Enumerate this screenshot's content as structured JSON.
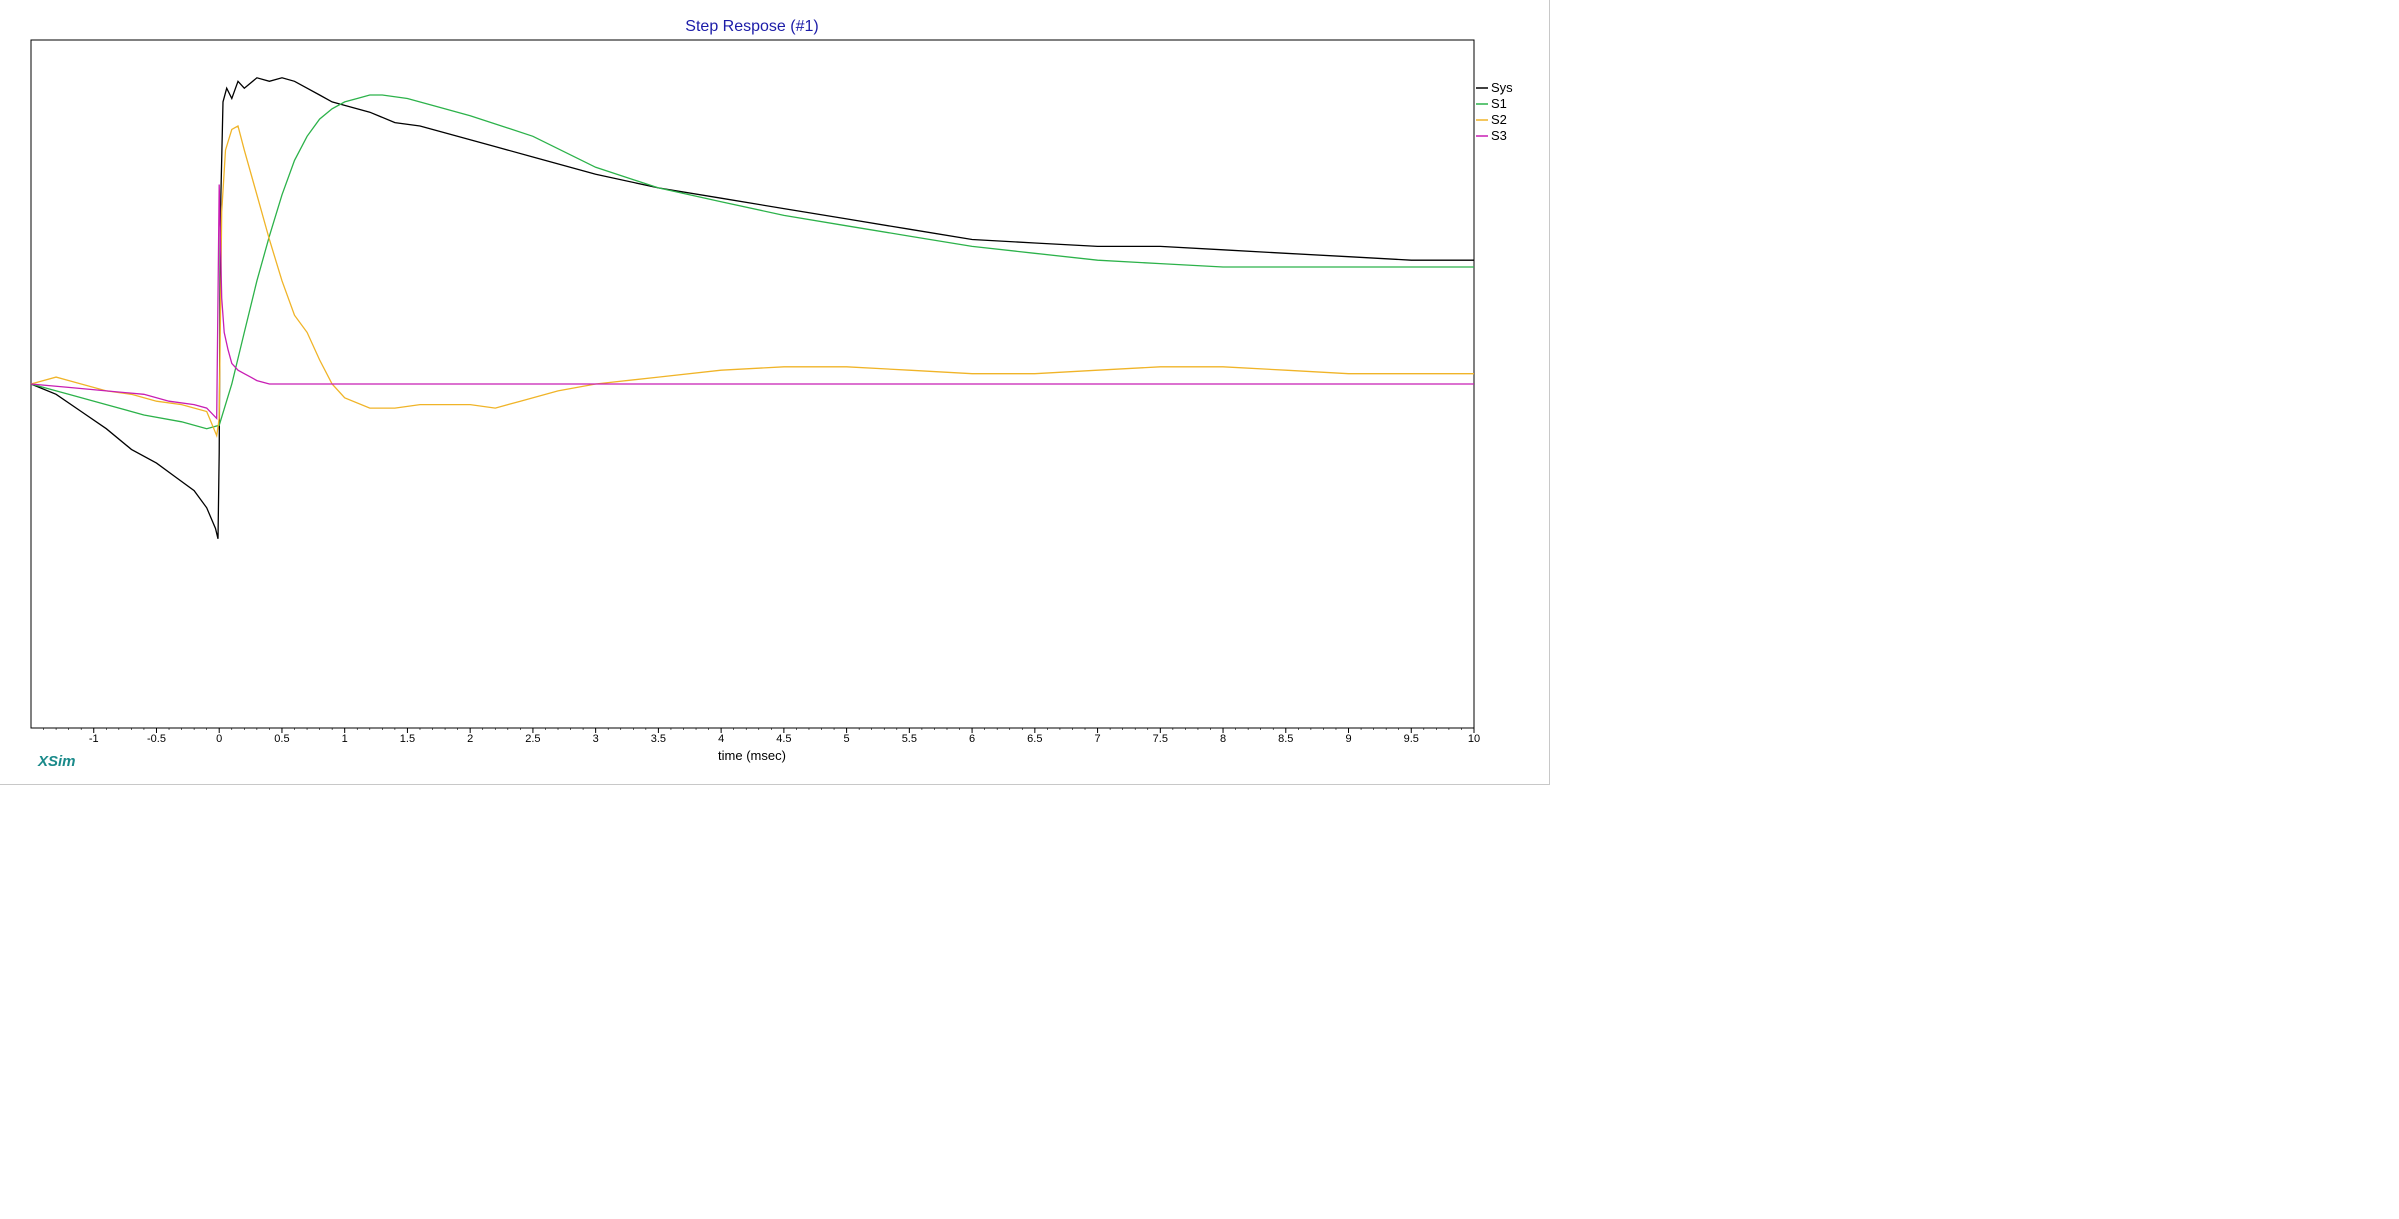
{
  "chart_data": {
    "type": "line",
    "title": "Step Respose (#1)",
    "xlabel": "time (msec)",
    "ylabel": "",
    "xlim": [
      -1.5,
      10
    ],
    "ylim": [
      -1.0,
      1.0
    ],
    "grid": false,
    "legend_position": "right-top",
    "x_ticks": [
      -1,
      -0.5,
      0,
      0.5,
      1,
      1.5,
      2,
      2.5,
      3,
      3.5,
      4,
      4.5,
      5,
      5.5,
      6,
      6.5,
      7,
      7.5,
      8,
      8.5,
      9,
      9.5,
      10
    ],
    "x_tick_labels": [
      "-1",
      "-0.5",
      "0",
      "0.5",
      "1",
      "1.5",
      "2",
      "2.5",
      "3",
      "3.5",
      "4",
      "4.5",
      "5",
      "5.5",
      "6",
      "6.5",
      "7",
      "7.5",
      "8",
      "8.5",
      "9",
      "9.5",
      "10"
    ],
    "series": [
      {
        "name": "Sys",
        "color": "#000000",
        "x": [
          -1.5,
          -1.3,
          -1.1,
          -0.9,
          -0.7,
          -0.5,
          -0.35,
          -0.2,
          -0.1,
          -0.03,
          -0.01,
          0.0,
          0.01,
          0.03,
          0.06,
          0.1,
          0.15,
          0.2,
          0.3,
          0.4,
          0.5,
          0.6,
          0.7,
          0.8,
          0.9,
          1.0,
          1.2,
          1.4,
          1.6,
          1.8,
          2.0,
          2.2,
          2.5,
          3.0,
          3.5,
          4.0,
          4.5,
          5.0,
          5.5,
          6.0,
          6.5,
          7.0,
          7.5,
          8.0,
          8.5,
          9.0,
          9.5,
          10.0
        ],
        "y": [
          0.0,
          -0.03,
          -0.08,
          -0.13,
          -0.19,
          -0.23,
          -0.27,
          -0.31,
          -0.36,
          -0.42,
          -0.45,
          -0.2,
          0.5,
          0.82,
          0.86,
          0.83,
          0.88,
          0.86,
          0.89,
          0.88,
          0.89,
          0.88,
          0.86,
          0.84,
          0.82,
          0.81,
          0.79,
          0.76,
          0.75,
          0.73,
          0.71,
          0.69,
          0.66,
          0.61,
          0.57,
          0.54,
          0.51,
          0.48,
          0.45,
          0.42,
          0.41,
          0.4,
          0.4,
          0.39,
          0.38,
          0.37,
          0.36,
          0.36
        ]
      },
      {
        "name": "S1",
        "color": "#2cb24a",
        "x": [
          -1.5,
          -1.2,
          -0.9,
          -0.6,
          -0.3,
          -0.1,
          0.0,
          0.1,
          0.2,
          0.3,
          0.4,
          0.5,
          0.6,
          0.7,
          0.8,
          0.9,
          1.0,
          1.1,
          1.2,
          1.3,
          1.5,
          1.7,
          2.0,
          2.5,
          3.0,
          3.5,
          4.0,
          4.5,
          5.0,
          5.5,
          6.0,
          6.5,
          7.0,
          7.5,
          8.0,
          8.5,
          9.0,
          9.5,
          10.0
        ],
        "y": [
          0.0,
          -0.03,
          -0.06,
          -0.09,
          -0.11,
          -0.13,
          -0.12,
          0.0,
          0.15,
          0.3,
          0.43,
          0.55,
          0.65,
          0.72,
          0.77,
          0.8,
          0.82,
          0.83,
          0.84,
          0.84,
          0.83,
          0.81,
          0.78,
          0.72,
          0.63,
          0.57,
          0.53,
          0.49,
          0.46,
          0.43,
          0.4,
          0.38,
          0.36,
          0.35,
          0.34,
          0.34,
          0.34,
          0.34,
          0.34
        ]
      },
      {
        "name": "S2",
        "color": "#f0b428",
        "x": [
          -1.5,
          -1.3,
          -1.1,
          -0.9,
          -0.7,
          -0.5,
          -0.3,
          -0.1,
          -0.02,
          0.0,
          0.02,
          0.05,
          0.1,
          0.15,
          0.2,
          0.3,
          0.4,
          0.5,
          0.6,
          0.7,
          0.8,
          0.9,
          1.0,
          1.2,
          1.4,
          1.6,
          1.8,
          2.0,
          2.2,
          2.4,
          2.7,
          3.0,
          3.5,
          4.0,
          4.5,
          5.0,
          5.5,
          6.0,
          6.5,
          7.0,
          7.5,
          8.0,
          8.5,
          9.0,
          9.5,
          10.0
        ],
        "y": [
          0.0,
          0.02,
          0.0,
          -0.02,
          -0.03,
          -0.05,
          -0.06,
          -0.08,
          -0.15,
          -0.1,
          0.5,
          0.68,
          0.74,
          0.75,
          0.68,
          0.55,
          0.42,
          0.3,
          0.2,
          0.15,
          0.07,
          0.0,
          -0.04,
          -0.07,
          -0.07,
          -0.06,
          -0.06,
          -0.06,
          -0.07,
          -0.05,
          -0.02,
          0.0,
          0.02,
          0.04,
          0.05,
          0.05,
          0.04,
          0.03,
          0.03,
          0.04,
          0.05,
          0.05,
          0.04,
          0.03,
          0.03,
          0.03
        ]
      },
      {
        "name": "S3",
        "color": "#c81eb4",
        "x": [
          -1.5,
          -1.2,
          -0.9,
          -0.6,
          -0.4,
          -0.2,
          -0.1,
          -0.02,
          0.0,
          0.02,
          0.04,
          0.07,
          0.1,
          0.15,
          0.2,
          0.25,
          0.3,
          0.4,
          0.5,
          0.7,
          1.0,
          1.5,
          2.0,
          3.0,
          4.0,
          5.0,
          6.0,
          7.0,
          8.0,
          9.0,
          10.0
        ],
        "y": [
          0.0,
          -0.01,
          -0.02,
          -0.03,
          -0.05,
          -0.06,
          -0.07,
          -0.1,
          0.58,
          0.25,
          0.15,
          0.1,
          0.06,
          0.04,
          0.03,
          0.02,
          0.01,
          0.0,
          0.0,
          0.0,
          0.0,
          0.0,
          0.0,
          0.0,
          0.0,
          0.0,
          0.0,
          0.0,
          0.0,
          0.0,
          0.0
        ]
      }
    ]
  },
  "footer": {
    "logo_text": "XSim"
  }
}
